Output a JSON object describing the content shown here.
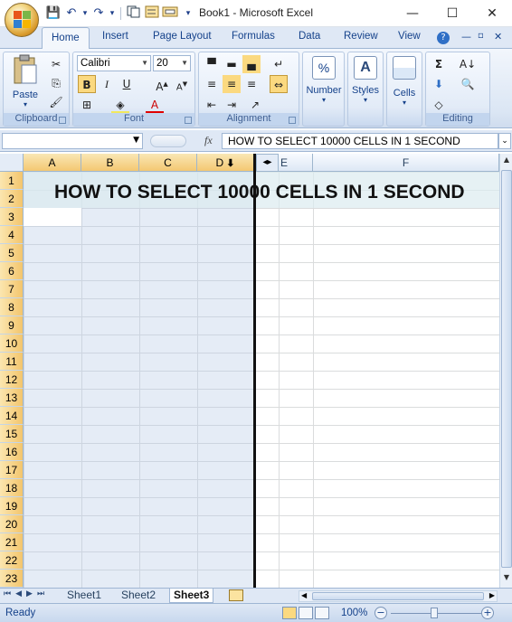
{
  "window": {
    "title": "Book1 - Microsoft Excel",
    "minimize": "—",
    "maximize": "☐",
    "close": "✕"
  },
  "qat": {
    "save": "💾",
    "undo": "↶",
    "redo": "↷",
    "dropdown": "▾"
  },
  "ribbon_tabs": [
    "Home",
    "Insert",
    "Page Layout",
    "Formulas",
    "Data",
    "Review",
    "View"
  ],
  "ribbon": {
    "clipboard": {
      "label": "Clipboard",
      "paste": "Paste"
    },
    "font": {
      "label": "Font",
      "font_name": "Calibri",
      "font_size": "20",
      "bold": "B",
      "italic": "I",
      "underline": "U"
    },
    "alignment": {
      "label": "Alignment"
    },
    "number": {
      "label": "Number",
      "icon": "%"
    },
    "styles": {
      "label": "Styles"
    },
    "cells": {
      "label": "Cells"
    },
    "editing": {
      "label": "Editing",
      "sum": "Σ"
    }
  },
  "formula_bar": {
    "name_box": "",
    "fx": "fx",
    "content": "HOW TO SELECT 10000 CELLS IN 1 SECOND"
  },
  "columns": [
    "A",
    "B",
    "C",
    "D",
    "E",
    "F"
  ],
  "rows": [
    "1",
    "2",
    "3",
    "4",
    "5",
    "6",
    "7",
    "8",
    "9",
    "10",
    "11",
    "12",
    "13",
    "14",
    "15",
    "16",
    "17",
    "18",
    "19",
    "20",
    "21",
    "22",
    "23"
  ],
  "cell_text": "HOW TO SELECT 10000 CELLS IN 1 SECOND",
  "sheets": [
    "Sheet1",
    "Sheet2",
    "Sheet3"
  ],
  "active_sheet": "Sheet3",
  "status": {
    "ready": "Ready",
    "zoom": "100%",
    "zoom_out": "−",
    "zoom_in": "+"
  }
}
